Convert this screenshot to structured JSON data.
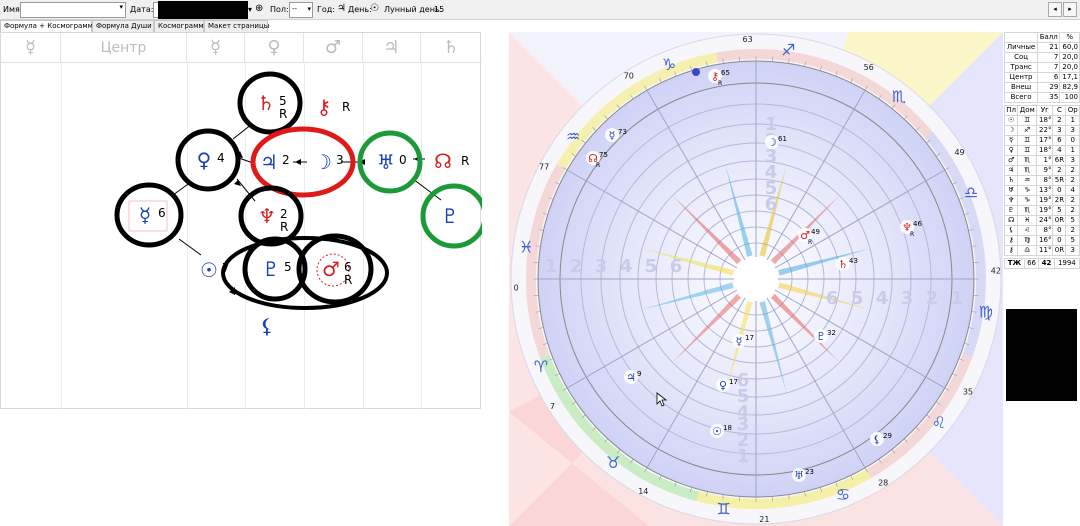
{
  "toolbar": {
    "name_label": "Имя:",
    "date_label": "Дата:",
    "sex_label": "Пол:",
    "sex_value": "--",
    "year_label": "Год:",
    "year_symbol": "♃",
    "day_label": "День:",
    "day_symbol": "☉",
    "lunar_day_label": "Лунный день:",
    "lunar_day_value": "15",
    "globe_icon": "globe-icon",
    "nav_left": "◂",
    "nav_right": "▸"
  },
  "tabs": [
    {
      "label": "Формула + Космограмма",
      "active": true
    },
    {
      "label": "Формула Души",
      "active": false
    },
    {
      "label": "Космограмма",
      "active": false
    },
    {
      "label": "Макет страницы",
      "active": false
    }
  ],
  "formula": {
    "columns": [
      {
        "label": "☿"
      },
      {
        "label": "Центр"
      },
      {
        "label": "☿"
      },
      {
        "label": "♀"
      },
      {
        "label": "♂"
      },
      {
        "label": "♃"
      },
      {
        "label": "♄"
      }
    ],
    "nodes": [
      {
        "id": "saturn",
        "symbol": "♄",
        "num": "5",
        "r": "R",
        "color": "#d32020",
        "ring": "#000"
      },
      {
        "id": "chiron",
        "symbol": "⚷",
        "num": "",
        "r": "R",
        "color": "#d32020",
        "ring": ""
      },
      {
        "id": "venus",
        "symbol": "♀",
        "num": "4",
        "r": "",
        "color": "#1a3fb8",
        "ring": "#000"
      },
      {
        "id": "jupiter",
        "symbol": "♃",
        "num": "2",
        "r": "",
        "color": "#1a3fb8",
        "ring": "#e01818"
      },
      {
        "id": "moon",
        "symbol": "☽",
        "num": "3",
        "r": "",
        "color": "#1a3fb8",
        "ring": "#e01818"
      },
      {
        "id": "uranus",
        "symbol": "♅",
        "num": "0",
        "r": "",
        "color": "#1a3fb8",
        "ring": "#1c9a3a"
      },
      {
        "id": "node",
        "symbol": "☊",
        "num": "",
        "r": "R",
        "color": "#d32020",
        "ring": ""
      },
      {
        "id": "mercury",
        "symbol": "☿",
        "num": "6",
        "r": "",
        "color": "#1a3fb8",
        "ring": "#000"
      },
      {
        "id": "neptune",
        "symbol": "♆",
        "num": "2",
        "r": "R",
        "color": "#d32020",
        "ring": "#000"
      },
      {
        "id": "pluto_green",
        "symbol": "♇",
        "num": "",
        "r": "",
        "color": "#1a3fb8",
        "ring": "#1c9a3a"
      },
      {
        "id": "sun",
        "symbol": "☉",
        "num": "7",
        "r": "",
        "color": "#1a3fb8",
        "ring": ""
      },
      {
        "id": "pluto",
        "symbol": "♇",
        "num": "5",
        "r": "",
        "color": "#1a3fb8",
        "ring": "#000"
      },
      {
        "id": "mars",
        "symbol": "♂",
        "num": "6",
        "r": "R",
        "color": "#d32020",
        "ring": "#000"
      },
      {
        "id": "lilith",
        "symbol": "⚸",
        "num": "",
        "r": "",
        "color": "#1a3fb8",
        "ring": ""
      }
    ]
  },
  "chart": {
    "degree_labels": [
      "63",
      "56",
      "49",
      "42",
      "35",
      "28",
      "21",
      "14",
      "7",
      "0",
      "77",
      "70"
    ],
    "zodiac": [
      "♉",
      "♊",
      "♋",
      "♌",
      "♍",
      "♎",
      "♏",
      "♐",
      "♑",
      "♒",
      "♓",
      "♈"
    ],
    "ring_numbers_north": [
      "4",
      "5",
      "6"
    ],
    "ring_numbers_south": [
      "4",
      "5",
      "6"
    ],
    "ring_numbers_west": [
      "1",
      "2",
      "3",
      "4",
      "5",
      "6"
    ],
    "ring_numbers_east": [
      "1",
      "2",
      "3",
      "4",
      "5",
      "6"
    ],
    "markers": [
      {
        "symbol": "⚷",
        "label": "65",
        "r": "R",
        "color": "#d32020"
      },
      {
        "symbol": "☿",
        "label": "73",
        "r": "",
        "color": "#1a3fb8"
      },
      {
        "symbol": "☊",
        "label": "75",
        "r": "R",
        "color": "#d32020"
      },
      {
        "symbol": "☽",
        "label": "61",
        "r": "",
        "color": "#1a3fb8"
      },
      {
        "symbol": "♂",
        "label": "49",
        "r": "R",
        "color": "#d32020"
      },
      {
        "symbol": "♆",
        "label": "46",
        "r": "R",
        "color": "#d32020"
      },
      {
        "symbol": "♄",
        "label": "43",
        "r": "",
        "color": "#d32020"
      },
      {
        "symbol": "♇",
        "label": "32",
        "r": "",
        "color": "#1a3fb8"
      },
      {
        "symbol": "☿",
        "label": "17",
        "r": "",
        "color": "#1a3fb8"
      },
      {
        "symbol": "♀",
        "label": "17",
        "r": "",
        "color": "#1a3fb8"
      },
      {
        "symbol": "♃",
        "label": "9",
        "r": "",
        "color": "#1a3fb8"
      },
      {
        "symbol": "☉",
        "label": "18",
        "r": "",
        "color": "#1a3fb8"
      },
      {
        "symbol": "⚸",
        "label": "29",
        "r": "",
        "color": "#1a3fb8"
      },
      {
        "symbol": "♅",
        "label": "23",
        "r": "",
        "color": "#1a3fb8"
      }
    ]
  },
  "side": {
    "score_header": [
      "",
      "Балл",
      "%"
    ],
    "score_rows": [
      [
        "Личные",
        "21",
        "60,0"
      ],
      [
        "Соц",
        "7",
        "20,0"
      ],
      [
        "Транс",
        "7",
        "20,0"
      ],
      [
        "Центр",
        "6",
        "17,1"
      ],
      [
        "Внеш",
        "29",
        "82,9"
      ],
      [
        "Всего",
        "35",
        "100"
      ]
    ],
    "planet_header": [
      "Пл",
      "Дом",
      "Уг",
      "С",
      "Ор"
    ],
    "planet_rows": [
      [
        "☉",
        "♊",
        "18°",
        "2",
        "1"
      ],
      [
        "☽",
        "♐",
        "22°",
        "3",
        "3"
      ],
      [
        "☿",
        "♊",
        "17°",
        "6",
        "0"
      ],
      [
        "♀",
        "♊",
        "18°",
        "4",
        "1"
      ],
      [
        "♂",
        "♏",
        "1°",
        "6R",
        "3"
      ],
      [
        "♃",
        "♏",
        "9°",
        "2",
        "2"
      ],
      [
        "♄",
        "♒",
        "8°",
        "5R",
        "2"
      ],
      [
        "♅",
        "♑",
        "13°",
        "0",
        "4"
      ],
      [
        "♆",
        "♑",
        "19°",
        "2R",
        "2"
      ],
      [
        "♇",
        "♏",
        "19°",
        "5",
        "2"
      ],
      [
        "☊",
        "♓",
        "24°",
        "0R",
        "5"
      ],
      [
        "⚸",
        "♌",
        "8°",
        "0",
        "2"
      ],
      [
        "⚷",
        "♍",
        "16°",
        "0",
        "5"
      ],
      [
        "⚷",
        "♎",
        "11°",
        "0R",
        "3"
      ]
    ],
    "footer": [
      "ТЖ",
      "66",
      "42",
      "1994"
    ]
  }
}
